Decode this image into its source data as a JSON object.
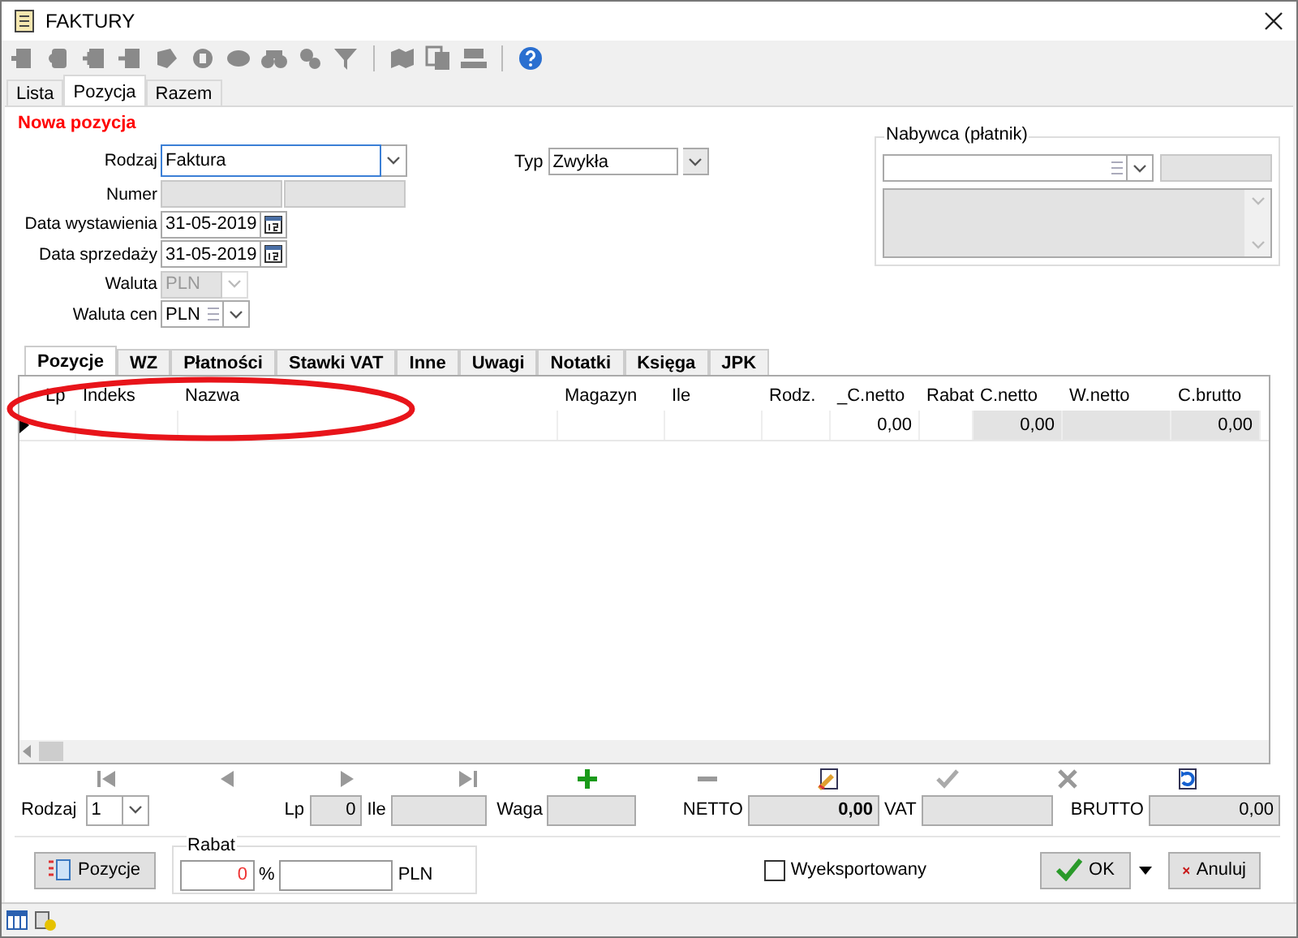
{
  "window": {
    "title": "FAKTURY"
  },
  "tabs": [
    {
      "label": "Lista",
      "selected": false
    },
    {
      "label": "Pozycja",
      "selected": true
    },
    {
      "label": "Razem",
      "selected": false
    }
  ],
  "form": {
    "section_title": "Nowa pozycja",
    "rodzaj": {
      "label": "Rodzaj",
      "value": "Faktura"
    },
    "numer": {
      "label": "Numer"
    },
    "data_wystawienia": {
      "label": "Data wystawienia",
      "value": "31-05-2019"
    },
    "data_sprzedazy": {
      "label": "Data sprzedaży",
      "value": "31-05-2019"
    },
    "waluta": {
      "label": "Waluta",
      "value": "PLN",
      "disabled": true
    },
    "waluta_cen": {
      "label": "Waluta cen",
      "value": "PLN",
      "disabled": false
    },
    "typ": {
      "label": "Typ",
      "value": "Zwykła"
    }
  },
  "buyer": {
    "title": "Nabywca (płatnik)"
  },
  "detail_tabs": [
    {
      "label": "Pozycje",
      "selected": true
    },
    {
      "label": "WZ",
      "selected": false
    },
    {
      "label": "Płatności",
      "selected": false
    },
    {
      "label": "Stawki VAT",
      "selected": false
    },
    {
      "label": "Inne",
      "selected": false
    },
    {
      "label": "Uwagi",
      "selected": false
    },
    {
      "label": "Notatki",
      "selected": false
    },
    {
      "label": "Księga",
      "selected": false
    },
    {
      "label": "JPK",
      "selected": false
    }
  ],
  "table": {
    "columns": [
      {
        "label": "Lp",
        "readonly": false
      },
      {
        "label": "Indeks",
        "readonly": false
      },
      {
        "label": "Nazwa",
        "readonly": false
      },
      {
        "label": "Magazyn",
        "readonly": false
      },
      {
        "label": "Ile",
        "readonly": false
      },
      {
        "label": "Rodz.",
        "readonly": false
      },
      {
        "label": "_C.netto",
        "readonly": false
      },
      {
        "label": "Rabat",
        "readonly": false
      },
      {
        "label": "C.netto",
        "readonly": true
      },
      {
        "label": "W.netto",
        "readonly": true
      },
      {
        "label": "C.brutto",
        "readonly": true
      }
    ],
    "rows": [
      {
        "selected": true,
        "cells": [
          null,
          null,
          null,
          null,
          null,
          null,
          "0,00",
          null,
          "0,00",
          null,
          "0,00"
        ]
      }
    ]
  },
  "footer": {
    "rodzaj": {
      "label": "Rodzaj",
      "value": "1"
    },
    "lp": {
      "label": "Lp",
      "value": "0"
    },
    "ile": {
      "label": "Ile"
    },
    "waga": {
      "label": "Waga"
    },
    "netto": {
      "label": "NETTO",
      "value": "0,00"
    },
    "vat": {
      "label": "VAT"
    },
    "brutto": {
      "label": "BRUTTO",
      "value": "0,00"
    }
  },
  "positions_button": "Pozycje",
  "rabat": {
    "title": "Rabat",
    "percent": "0",
    "percent_sign": "%",
    "currency": "PLN"
  },
  "exported": {
    "label": "Wyeksportowany",
    "checked": false
  },
  "buttons": {
    "ok": "OK",
    "cancel": "Anuluj"
  }
}
